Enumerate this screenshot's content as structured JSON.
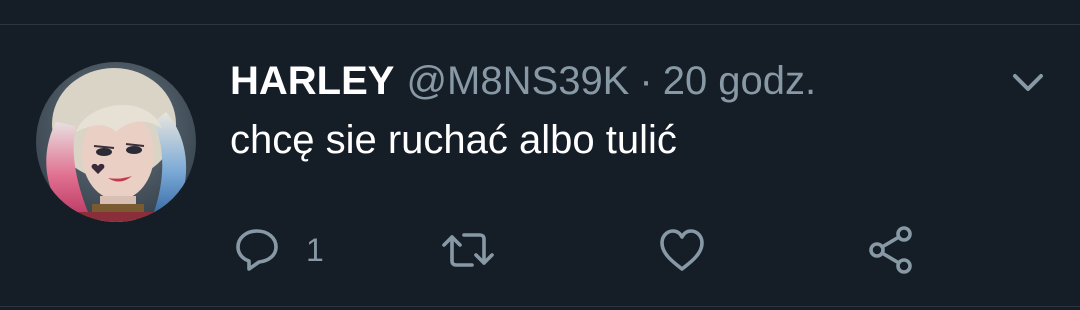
{
  "tweet": {
    "display_name": "HARLEY",
    "handle": "@M8NS39K",
    "separator": "·",
    "time": "20 godz.",
    "text": "chcę sie ruchać albo tulić",
    "avatar": "profile-avatar-woman-blonde-hair-pink-blue-tips",
    "more_icon": "chevron-down-icon"
  },
  "actions": {
    "reply": {
      "icon": "reply-icon",
      "count": "1"
    },
    "retweet": {
      "icon": "retweet-icon"
    },
    "like": {
      "icon": "heart-icon"
    },
    "share": {
      "icon": "share-icon"
    }
  },
  "colors": {
    "background": "#151d27",
    "divider": "#2b3640",
    "text_primary": "#ffffff",
    "text_secondary": "#8899a6"
  }
}
